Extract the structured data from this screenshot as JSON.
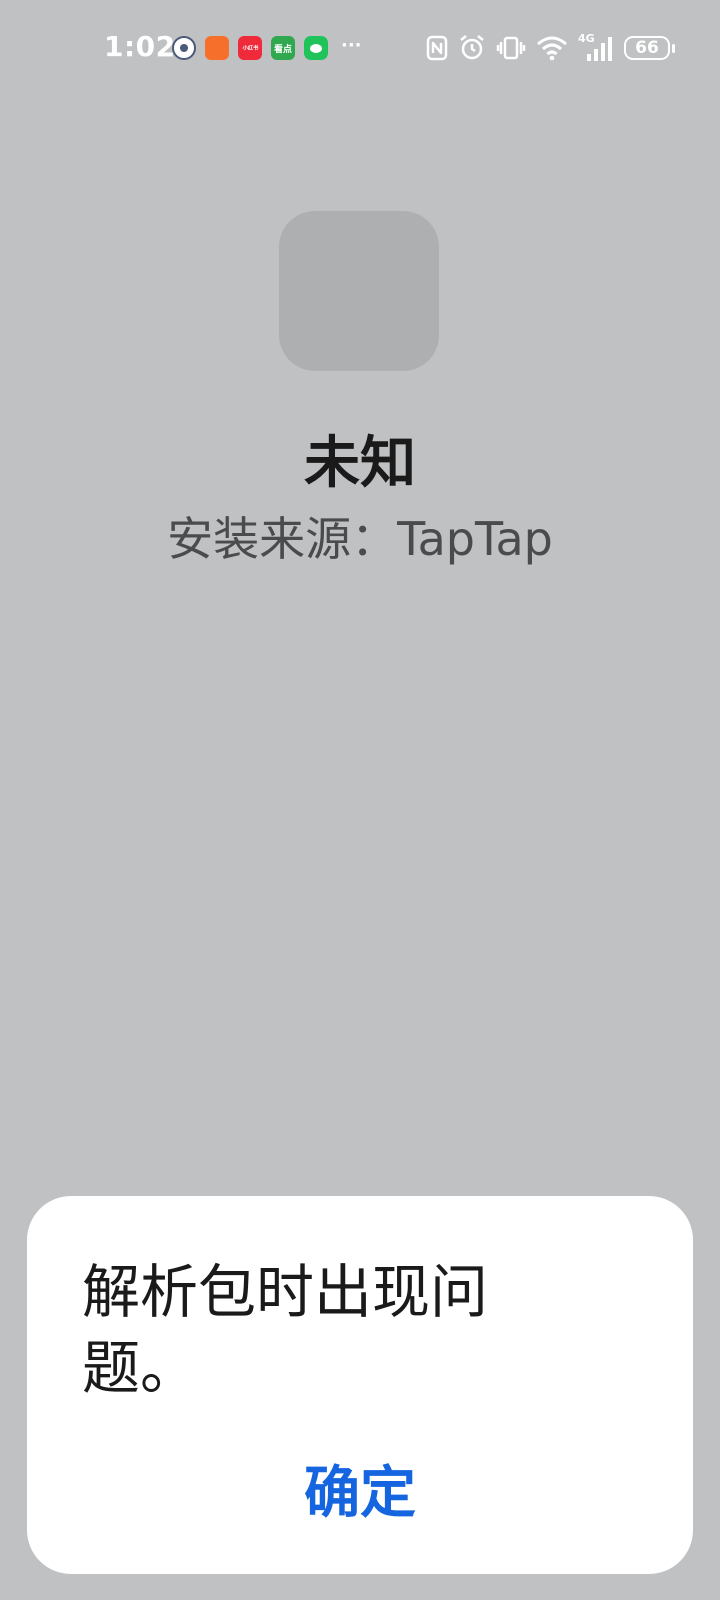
{
  "status_bar": {
    "time": "1:02",
    "battery": "66",
    "network": "4G",
    "notification_icons": [
      "gov-app-icon",
      "orange-app-icon",
      "xiaohongshu-icon",
      "kandian-icon",
      "wechat-icon"
    ],
    "more": "···",
    "notification_labels": {
      "xiaohongshu": "小红书",
      "kandian": "看点"
    }
  },
  "app": {
    "name": "未知",
    "source": "安装来源：TapTap"
  },
  "dialog": {
    "message": "解析包时出现问题。",
    "confirm_label": "确定"
  },
  "colors": {
    "background": "#c0c1c3",
    "accent": "#1565e0",
    "dialog": "#ffffff",
    "placeholder_icon": "#aeafb1"
  }
}
